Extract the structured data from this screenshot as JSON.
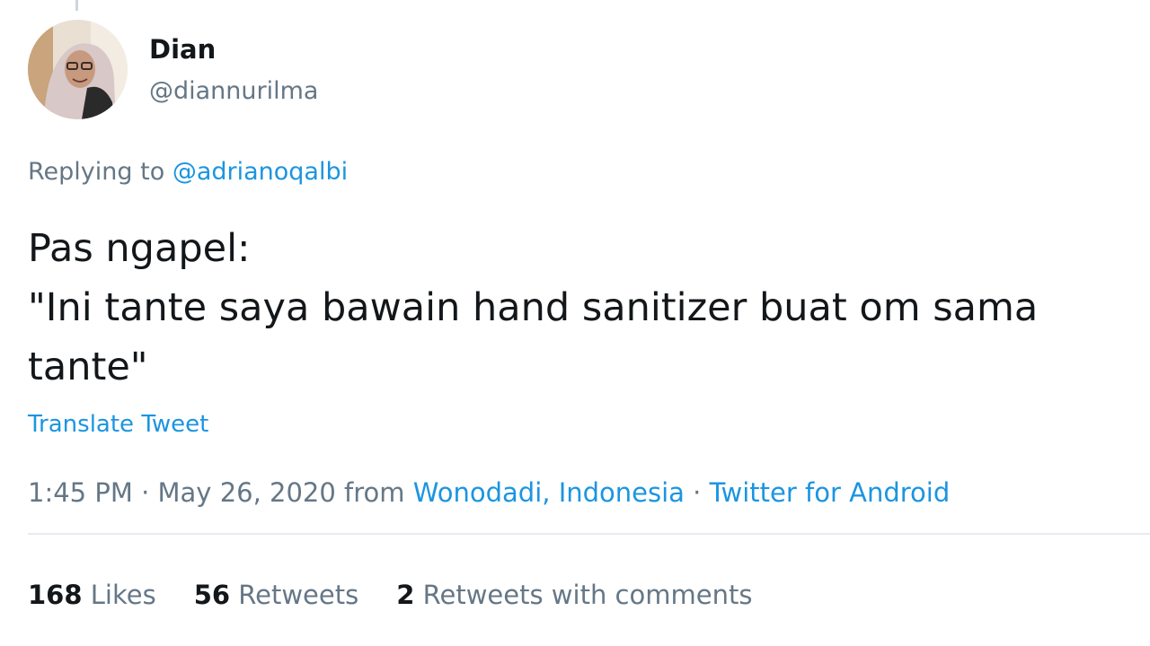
{
  "user": {
    "display_name": "Dian",
    "handle": "@diannurilma"
  },
  "reply": {
    "prefix": "Replying to ",
    "mention": "@adrianoqalbi"
  },
  "tweet": {
    "text": "Pas ngapel:\n\"Ini tante saya bawain hand sanitizer buat om sama tante\""
  },
  "translate_label": "Translate Tweet",
  "meta": {
    "time": "1:45 PM",
    "sep1": " · ",
    "date": "May 26, 2020",
    "from": " from ",
    "location": "Wonodadi, Indonesia",
    "sep2": " · ",
    "client": "Twitter for Android"
  },
  "stats": {
    "likes": {
      "count": "168",
      "label": " Likes"
    },
    "retweets": {
      "count": "56",
      "label": " Retweets"
    },
    "quotes": {
      "count": "2",
      "label": " Retweets with comments"
    }
  },
  "colors": {
    "link": "#1b95e0",
    "muted": "#657786",
    "text": "#14171a",
    "divider": "#e6ecf0"
  }
}
